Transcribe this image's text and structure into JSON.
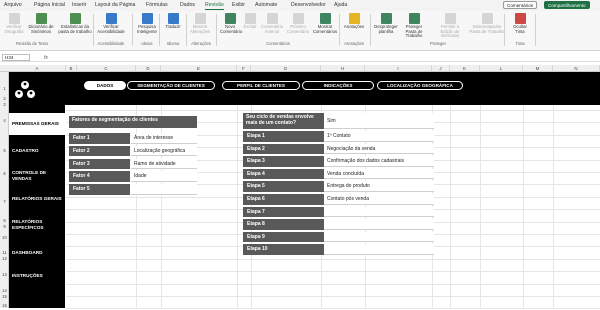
{
  "menu": [
    "Arquivo",
    "Página Inicial",
    "Inserir",
    "Layout da Página",
    "Fórmulas",
    "Dados",
    "Revisão",
    "Exibir",
    "Automate",
    "Desenvolvedor",
    "Ajuda"
  ],
  "menu_active_index": 6,
  "top_buttons": {
    "comments": "Comentários",
    "share": "Compartilhamento"
  },
  "ribbon": {
    "buttons": [
      {
        "label": "Verificar Ortografia",
        "icon": "spellcheck-icon",
        "enabled": false
      },
      {
        "label": "Dicionário de Sinônimos",
        "icon": "thesaurus-icon",
        "enabled": true
      },
      {
        "label": "Estatísticas da pasta de trabalho",
        "icon": "stats-icon",
        "enabled": true
      },
      {
        "label": "Verificar Acessibilidade",
        "icon": "accessibility-icon",
        "enabled": true
      },
      {
        "label": "Pesquisa Inteligente",
        "icon": "smart-lookup-icon",
        "enabled": true
      },
      {
        "label": "Traduzir",
        "icon": "translate-icon",
        "enabled": true
      },
      {
        "label": "Mostrar Alterações",
        "icon": "changes-icon",
        "enabled": false
      },
      {
        "label": "Novo Comentário",
        "icon": "new-comment-icon",
        "enabled": true
      },
      {
        "label": "Excluir",
        "icon": "delete-comment-icon",
        "enabled": false
      },
      {
        "label": "Comentário Anterior",
        "icon": "prev-comment-icon",
        "enabled": false
      },
      {
        "label": "Próximo Comentário",
        "icon": "next-comment-icon",
        "enabled": false
      },
      {
        "label": "Mostrar Comentários",
        "icon": "show-comments-icon",
        "enabled": true
      },
      {
        "label": "Anotações",
        "icon": "notes-icon",
        "enabled": true
      },
      {
        "label": "Desproteger planilha",
        "icon": "unprotect-sheet-icon",
        "enabled": true
      },
      {
        "label": "Proteger Pasta de Trabalho",
        "icon": "protect-workbook-icon",
        "enabled": true
      },
      {
        "label": "Permitir a Edição de Intervalos",
        "icon": "allow-edit-icon",
        "enabled": false
      },
      {
        "label": "Desencapsular Pasta de Trabalho",
        "icon": "unshare-icon",
        "enabled": false
      },
      {
        "label": "Ocultar Tinta",
        "icon": "hide-ink-icon",
        "enabled": true
      }
    ],
    "groups": [
      "Revisão de Texto",
      "Acessibilidade",
      "Ideias",
      "Idioma",
      "Alterações",
      "Comentários",
      "Anotações",
      "Proteger",
      "Tinta"
    ]
  },
  "name_box": "H34",
  "formula_symbol": "fx",
  "columns": [
    "A",
    "B",
    "C",
    "D",
    "E",
    "F",
    "G",
    "H",
    "I",
    "J",
    "K",
    "L",
    "M",
    "N"
  ],
  "rows": [
    "1",
    "2",
    "3",
    "4",
    "5",
    "6",
    "7",
    "8",
    "9",
    "10",
    "11",
    "12",
    "13",
    "14",
    "15",
    "16"
  ],
  "nav_tabs": [
    "DADOS",
    "SEGMENTAÇÃO DE CLIENTES",
    "PERFIL DE CLIENTES",
    "INDICAÇÕES",
    "LOCALIZAÇÃO GEOGRÁFICA"
  ],
  "nav_active_index": 0,
  "sidebar": [
    "PREMISSAS GERAIS",
    "CADASTRO",
    "CONTROLE DE VENDAS",
    "RELATÓRIOS GERAIS",
    "RELATÓRIOS ESPECÍFICOS",
    "DASHBOARD",
    "INSTRUÇÕES"
  ],
  "sidebar_active_index": 0,
  "segmentation": {
    "header": "Fatores de segmentação de clientes",
    "rows": [
      {
        "label": "Fator 1",
        "value": "Área de interesse"
      },
      {
        "label": "Fator 2",
        "value": "Localização geográfica"
      },
      {
        "label": "Fator 3",
        "value": "Ramo de atividade"
      },
      {
        "label": "Fator 4",
        "value": "Idade"
      },
      {
        "label": "Fator 5",
        "value": ""
      }
    ]
  },
  "sales_cycle": {
    "header": "Seu ciclo de vendas envolve mais de um contato?",
    "answer": "Sim",
    "rows": [
      {
        "label": "Etapa 1",
        "value": "1º Contato"
      },
      {
        "label": "Etapa 2",
        "value": "Negociação da venda"
      },
      {
        "label": "Etapa 3",
        "value": "Confirmação dos dados cadastrais"
      },
      {
        "label": "Etapa 4",
        "value": "Venda concluída"
      },
      {
        "label": "Etapa 5",
        "value": "Entrega do produto"
      },
      {
        "label": "Etapa 6",
        "value": "Contato pós venda"
      },
      {
        "label": "Etapa 7",
        "value": ""
      },
      {
        "label": "Etapa 8",
        "value": ""
      },
      {
        "label": "Etapa 9",
        "value": ""
      },
      {
        "label": "Etapa 10",
        "value": ""
      }
    ]
  }
}
